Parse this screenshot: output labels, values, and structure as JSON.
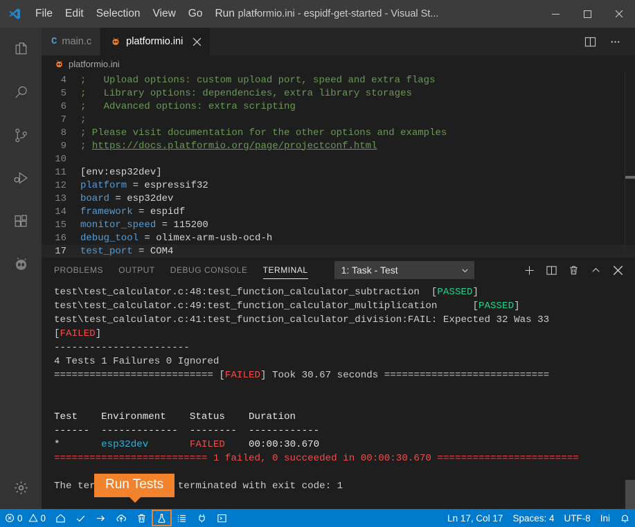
{
  "titlebar": {
    "logo_icon": "vscode-logo-icon",
    "menu": [
      "File",
      "Edit",
      "Selection",
      "View",
      "Go",
      "Run",
      "⋯"
    ],
    "window_title": "platformio.ini - espidf-get-started - Visual St...",
    "minimize_icon": "minimize-icon",
    "maximize_icon": "maximize-icon",
    "close_icon": "close-icon"
  },
  "activitybar": {
    "items": [
      {
        "name": "explorer",
        "icon": "files-icon",
        "active": false
      },
      {
        "name": "search",
        "icon": "search-icon",
        "active": false
      },
      {
        "name": "source-control",
        "icon": "source-control-icon",
        "active": false
      },
      {
        "name": "run-and-debug",
        "icon": "run-debug-icon",
        "active": false
      },
      {
        "name": "extensions",
        "icon": "extensions-icon",
        "active": false
      },
      {
        "name": "platformio",
        "icon": "platformio-alien-icon",
        "active": false
      }
    ],
    "manage": {
      "name": "manage",
      "icon": "gear-icon"
    }
  },
  "tabs": [
    {
      "label": "main.c",
      "icon": "c-file-icon",
      "active": false,
      "closable": false
    },
    {
      "label": "platformio.ini",
      "icon": "platformio-alien-icon",
      "active": true,
      "closable": true,
      "close_icon": "close-icon"
    }
  ],
  "editor_actions": [
    {
      "name": "split-editor",
      "icon": "split-editor-icon"
    },
    {
      "name": "more-actions",
      "icon": "more-actions-icon"
    }
  ],
  "breadcrumb": {
    "icon": "platformio-alien-icon",
    "label": "platformio.ini"
  },
  "editor": {
    "lines": [
      {
        "num": "4",
        "segments": [
          {
            "cls": "c-comment",
            "text": ";   Upload options: custom upload port, speed and extra flags"
          }
        ]
      },
      {
        "num": "5",
        "segments": [
          {
            "cls": "c-comment",
            "text": ";   Library options: dependencies, extra library storages"
          }
        ]
      },
      {
        "num": "6",
        "segments": [
          {
            "cls": "c-comment",
            "text": ";   Advanced options: extra scripting"
          }
        ]
      },
      {
        "num": "7",
        "segments": [
          {
            "cls": "c-comment",
            "text": ";"
          }
        ]
      },
      {
        "num": "8",
        "segments": [
          {
            "cls": "c-comment",
            "text": "; Please visit documentation for the other options and examples"
          }
        ]
      },
      {
        "num": "9",
        "segments": [
          {
            "cls": "c-comment",
            "text": "; "
          },
          {
            "cls": "c-link",
            "text": "https://docs.platformio.org/page/projectconf.html"
          }
        ]
      },
      {
        "num": "10",
        "segments": [
          {
            "cls": "c-val",
            "text": ""
          }
        ]
      },
      {
        "num": "11",
        "segments": [
          {
            "cls": "c-section",
            "text": "[env:esp32dev]"
          }
        ]
      },
      {
        "num": "12",
        "segments": [
          {
            "cls": "c-key",
            "text": "platform"
          },
          {
            "cls": "c-val",
            "text": " = espressif32"
          }
        ]
      },
      {
        "num": "13",
        "segments": [
          {
            "cls": "c-key",
            "text": "board"
          },
          {
            "cls": "c-val",
            "text": " = esp32dev"
          }
        ]
      },
      {
        "num": "14",
        "segments": [
          {
            "cls": "c-key",
            "text": "framework"
          },
          {
            "cls": "c-val",
            "text": " = espidf"
          }
        ]
      },
      {
        "num": "15",
        "segments": [
          {
            "cls": "c-key",
            "text": "monitor_speed"
          },
          {
            "cls": "c-val",
            "text": " = 115200"
          }
        ]
      },
      {
        "num": "16",
        "segments": [
          {
            "cls": "c-key",
            "text": "debug_tool"
          },
          {
            "cls": "c-val",
            "text": " = olimex-arm-usb-ocd-h"
          }
        ]
      },
      {
        "num": "17",
        "segments": [
          {
            "cls": "c-key",
            "text": "test_port"
          },
          {
            "cls": "c-val",
            "text": " = COM4"
          }
        ],
        "current": true
      }
    ]
  },
  "panel": {
    "tabs": [
      {
        "label": "PROBLEMS",
        "active": false
      },
      {
        "label": "OUTPUT",
        "active": false
      },
      {
        "label": "DEBUG CONSOLE",
        "active": false
      },
      {
        "label": "TERMINAL",
        "active": true
      }
    ],
    "terminal_selector": {
      "value": "1: Task - Test",
      "chevron_icon": "chevron-down-icon"
    },
    "actions": [
      {
        "name": "new-terminal",
        "icon": "plus-icon"
      },
      {
        "name": "split-terminal",
        "icon": "split-icon"
      },
      {
        "name": "kill-terminal",
        "icon": "trash-icon"
      },
      {
        "name": "maximize-panel",
        "icon": "chevron-up-icon"
      },
      {
        "name": "close-panel",
        "icon": "close-icon"
      }
    ]
  },
  "terminal": {
    "lines": [
      [
        {
          "cls": "t-dim",
          "text": "test\\test_calculator.c:48:test_function_calculator_subtraction  ["
        },
        {
          "cls": "t-pass",
          "text": "PASSED"
        },
        {
          "cls": "t-dim",
          "text": "]"
        }
      ],
      [
        {
          "cls": "t-dim",
          "text": "test\\test_calculator.c:49:test_function_calculator_multiplication      ["
        },
        {
          "cls": "t-pass",
          "text": "PASSED"
        },
        {
          "cls": "t-dim",
          "text": "]"
        }
      ],
      [
        {
          "cls": "t-dim",
          "text": "test\\test_calculator.c:41:test_function_calculator_division:FAIL: Expected 32 Was 33"
        }
      ],
      [
        {
          "cls": "t-dim",
          "text": "["
        },
        {
          "cls": "t-fail",
          "text": "FAILED"
        },
        {
          "cls": "t-dim",
          "text": "]"
        }
      ],
      [
        {
          "cls": "t-dim",
          "text": "-----------------------"
        }
      ],
      [
        {
          "cls": "t-dim",
          "text": "4 Tests 1 Failures 0 Ignored"
        }
      ],
      [
        {
          "cls": "t-dim",
          "text": "=========================== ["
        },
        {
          "cls": "t-fail",
          "text": "FAILED"
        },
        {
          "cls": "t-dim",
          "text": "] Took 30.67 seconds ============================"
        }
      ],
      [
        {
          "cls": "t-dim",
          "text": ""
        }
      ],
      [
        {
          "cls": "t-dim",
          "text": ""
        }
      ],
      [
        {
          "cls": "t-white",
          "text": "Test    Environment    Status    Duration"
        }
      ],
      [
        {
          "cls": "t-white",
          "text": "------  -------------  --------  ------------"
        }
      ],
      [
        {
          "cls": "t-white",
          "text": "*       "
        },
        {
          "cls": "t-cyan",
          "text": "esp32dev"
        },
        {
          "cls": "t-white",
          "text": "       "
        },
        {
          "cls": "t-fail",
          "text": "FAILED"
        },
        {
          "cls": "t-white",
          "text": "    00:00:30.670"
        }
      ],
      [
        {
          "cls": "t-fail",
          "text": "========================== 1 failed, 0 succeeded in 00:00:30.670 ========================"
        }
      ],
      [
        {
          "cls": "t-dim",
          "text": ""
        }
      ],
      [
        {
          "cls": "t-dim",
          "text": "The terminal process terminated with exit code: 1"
        }
      ]
    ]
  },
  "tooltip": {
    "label": "Run Tests"
  },
  "statusbar": {
    "left": [
      {
        "name": "problems",
        "icon": "error-icon",
        "label": "0",
        "icon2": "warning-icon",
        "label2": "0"
      },
      {
        "name": "pio-home",
        "icon": "home-icon",
        "label": ""
      },
      {
        "name": "pio-build",
        "icon": "check-icon",
        "label": ""
      },
      {
        "name": "pio-upload",
        "icon": "arrow-right-icon",
        "label": ""
      },
      {
        "name": "pio-upload-ota",
        "icon": "cloud-upload-icon",
        "label": ""
      },
      {
        "name": "pio-clean",
        "icon": "trash-icon",
        "label": ""
      },
      {
        "name": "pio-test",
        "icon": "flask-icon",
        "label": "",
        "highlighted": true
      },
      {
        "name": "pio-tasks",
        "icon": "list-icon",
        "label": ""
      },
      {
        "name": "pio-serial-monitor",
        "icon": "plug-icon",
        "label": ""
      },
      {
        "name": "pio-terminal",
        "icon": "terminal-icon",
        "label": ""
      }
    ],
    "right": [
      {
        "name": "cursor-position",
        "label": "Ln 17, Col 17"
      },
      {
        "name": "indentation",
        "label": "Spaces: 4"
      },
      {
        "name": "encoding",
        "label": "UTF-8"
      },
      {
        "name": "language-mode",
        "label": "Ini"
      },
      {
        "name": "notifications",
        "icon": "bell-icon",
        "label": ""
      }
    ]
  },
  "colors": {
    "accent": "#007acc",
    "tooltip_bg": "#f2832c",
    "pass": "#23d18b",
    "fail": "#f14c4c",
    "link_cyan": "#29b8db"
  }
}
